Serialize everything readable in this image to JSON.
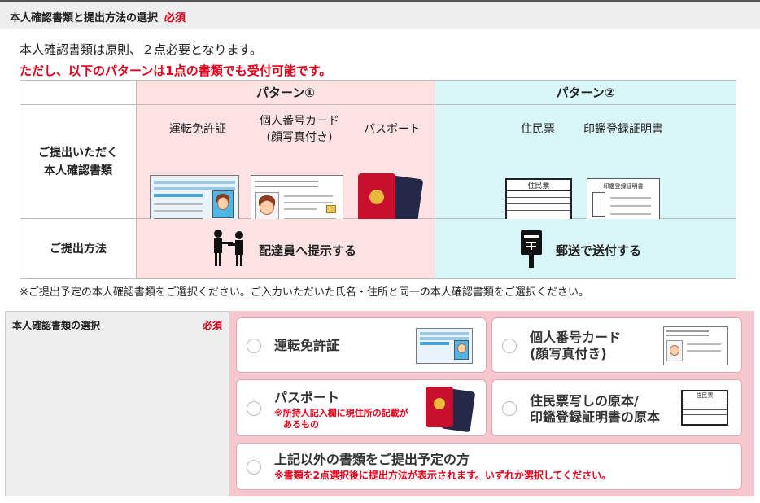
{
  "header": {
    "title": "本人確認書類と提出方法の選択",
    "required": "必須"
  },
  "intro": {
    "line1": "本人確認書類は原則、２点必要となります。",
    "line2": "ただし、以下のパターンは1点の書類でも受付可能です。"
  },
  "table": {
    "pattern1": "パターン①",
    "pattern2": "パターン②",
    "row_docs_label": "ご提出いただく\n本人確認書類",
    "row_method_label": "ご提出方法",
    "p1_docs": [
      "運転免許証",
      "個人番号カード\n(顔写真付き)",
      "パスポート"
    ],
    "p2_docs": [
      "住民票",
      "印鑑登録証明書"
    ],
    "p1_method": "配達員へ提示する",
    "p2_method": "郵送で送付する",
    "form_title_juminhyo": "住民票",
    "form_title_inkan": "印鑑登録証明書"
  },
  "note": "※ご提出予定の本人確認書類をご選択ください。ご入力いただいた氏名・住所と同一の本人確認書類をご選択ください。",
  "selection": {
    "title": "本人確認書類の選択",
    "required": "必須",
    "options": [
      {
        "label": "運転免許証",
        "sub": ""
      },
      {
        "label": "個人番号カード\n(顔写真付き)",
        "sub": ""
      },
      {
        "label": "パスポート",
        "sub": "※所持人記入欄に現住所の記載が\n　あるもの"
      },
      {
        "label": "住民票写しの原本/\n印鑑登録証明書の原本",
        "sub": ""
      },
      {
        "label": "上記以外の書類をご提出予定の方",
        "sub": "※書類を2点選択後に提出方法が表示されます。いずれか選択してください。"
      }
    ]
  },
  "colors": {
    "accent_red": "#e3001b",
    "pattern1_bg": "#fde2e4",
    "pattern2_bg": "#d9f6f8",
    "selection_bg": "#f7c7cf"
  },
  "icons": [
    "delivery-handover-icon",
    "mailbox-icon",
    "radio-icon"
  ]
}
